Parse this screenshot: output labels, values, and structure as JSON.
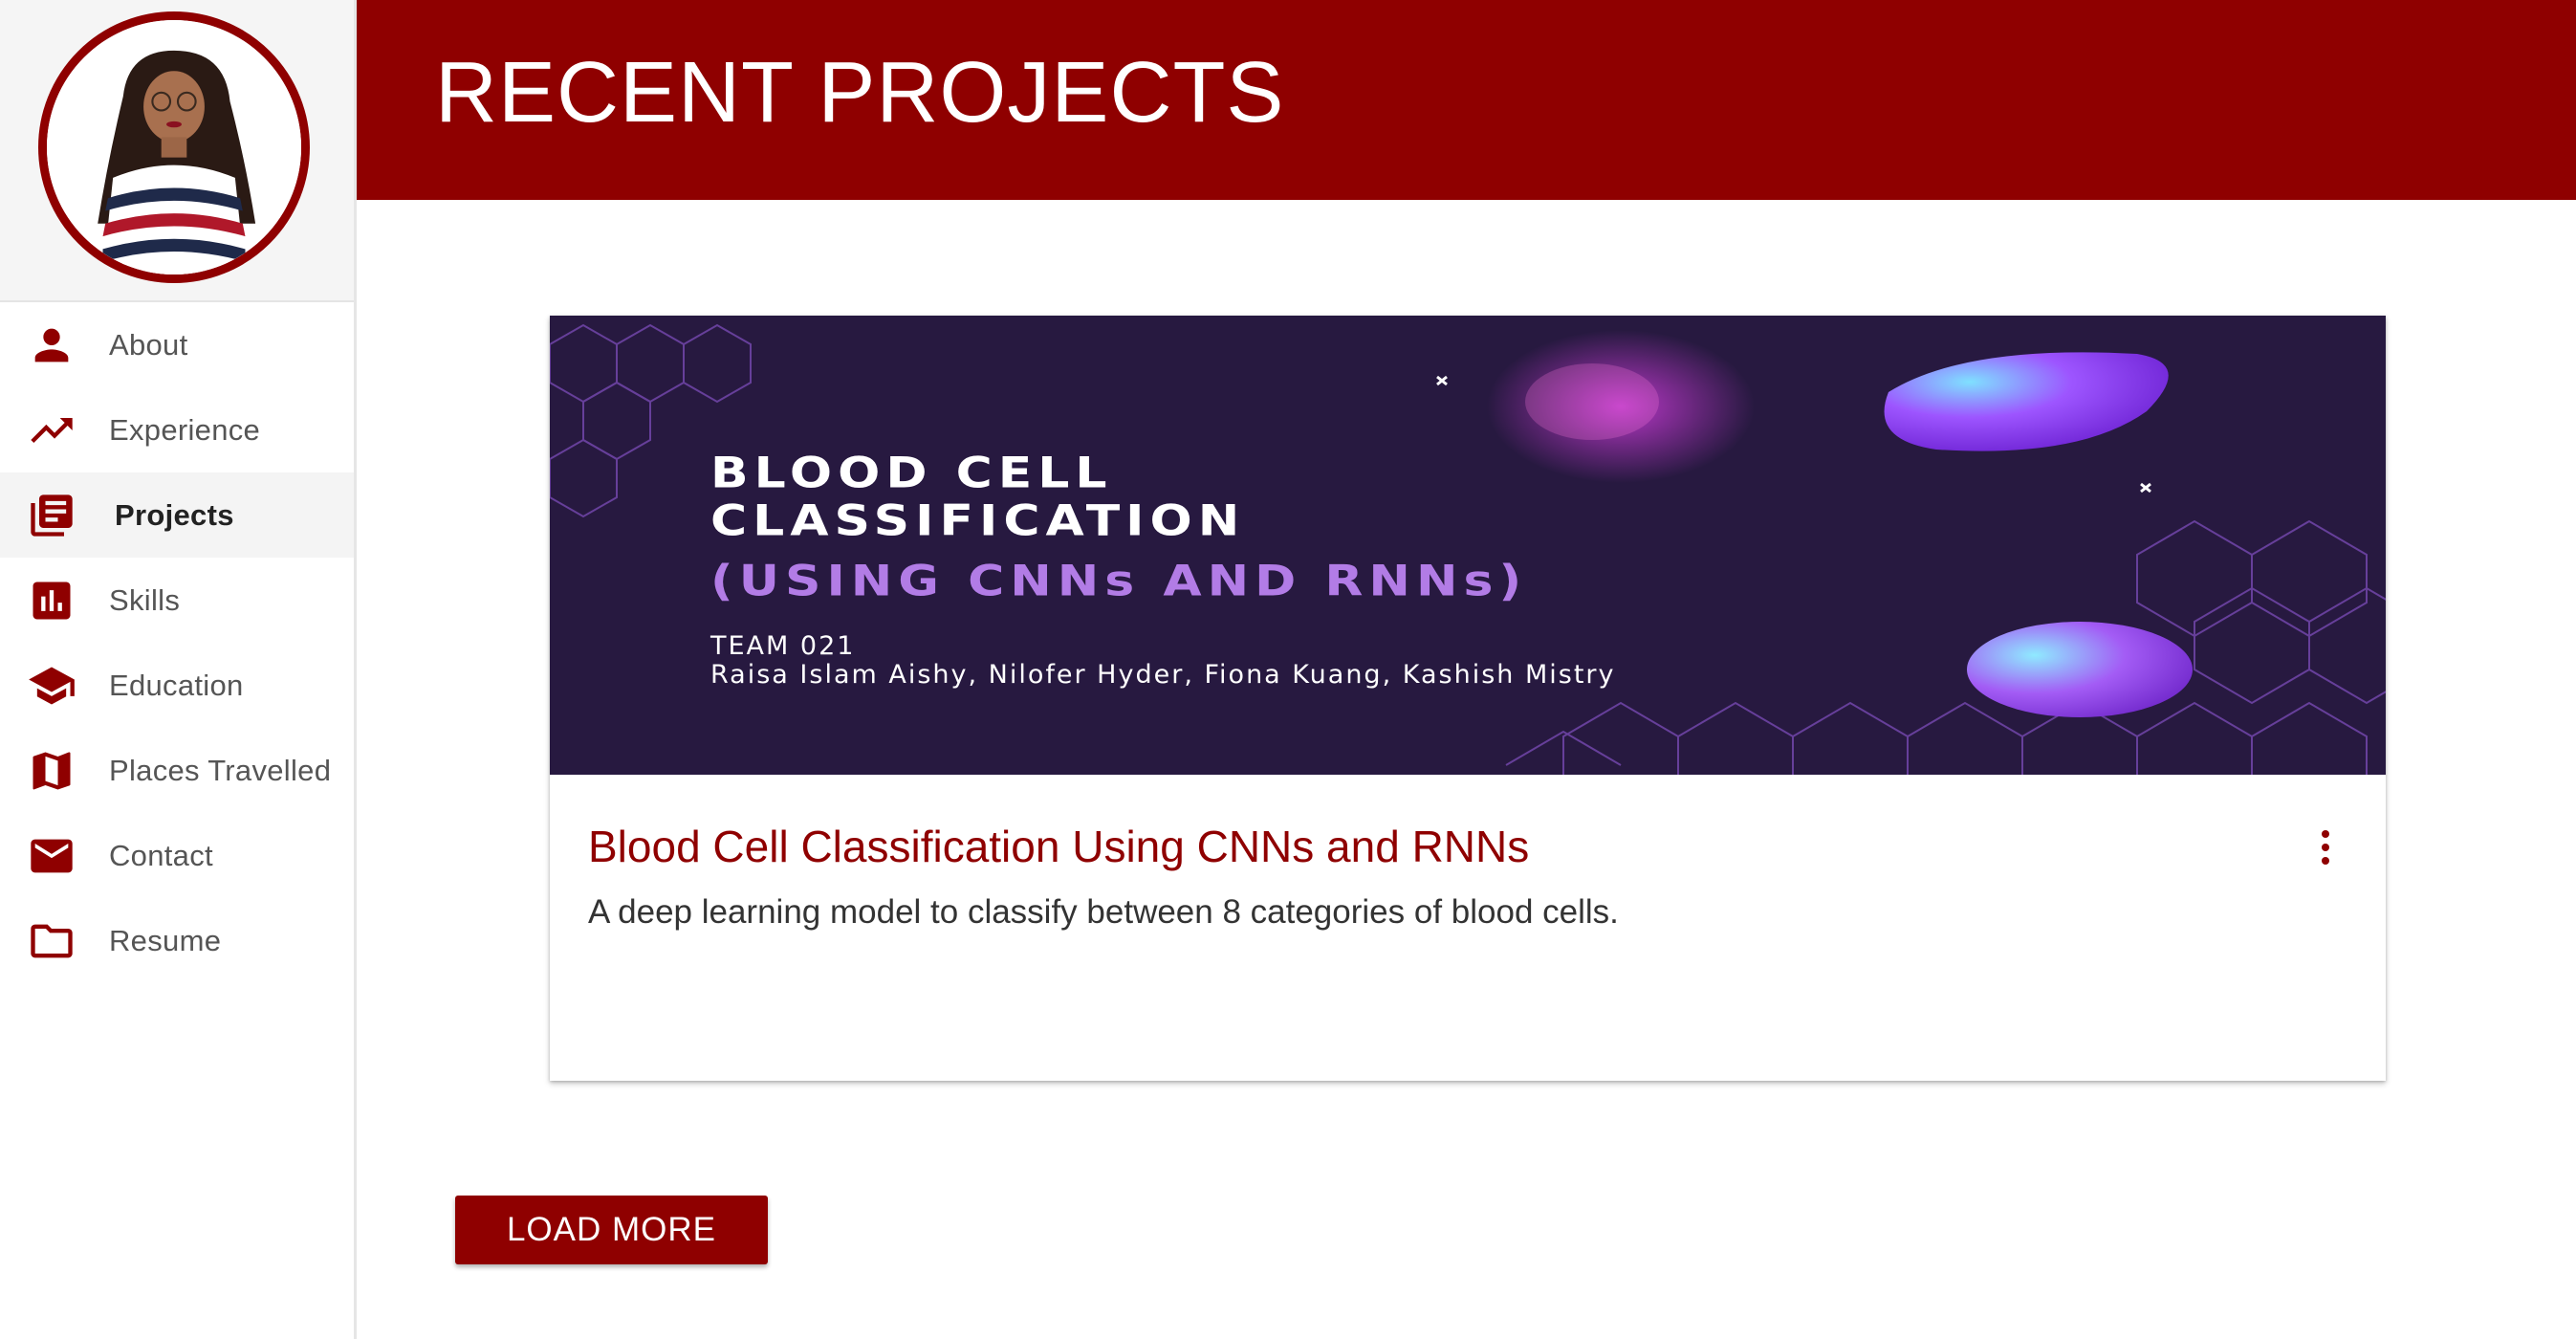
{
  "header": {
    "title": "RECENT PROJECTS"
  },
  "sidebar": {
    "items": [
      {
        "label": "About",
        "icon": "person-icon"
      },
      {
        "label": "Experience",
        "icon": "trending-up-icon"
      },
      {
        "label": "Projects",
        "icon": "library-books-icon",
        "active": true
      },
      {
        "label": "Skills",
        "icon": "bar-chart-icon"
      },
      {
        "label": "Education",
        "icon": "graduation-cap-icon"
      },
      {
        "label": "Places Travelled",
        "icon": "map-icon"
      },
      {
        "label": "Contact",
        "icon": "mail-icon"
      },
      {
        "label": "Resume",
        "icon": "folder-icon"
      }
    ]
  },
  "project": {
    "banner": {
      "title_line1": "BLOOD CELL",
      "title_line2": "CLASSIFICATION",
      "subtitle": "(USING CNNs AND RNNs)",
      "team": "TEAM 021",
      "members": "Raisa Islam Aishy, Nilofer Hyder, Fiona Kuang, Kashish Mistry"
    },
    "title": "Blood Cell Classification Using CNNs and RNNs",
    "description": "A deep learning model to classify between 8 categories of blood cells.",
    "menu_icon": "more-vert-icon"
  },
  "load_more": {
    "label": "LOAD MORE"
  },
  "colors": {
    "accent": "#8f0000",
    "banner_bg": "#271940",
    "banner_purple": "#b27ce6"
  }
}
